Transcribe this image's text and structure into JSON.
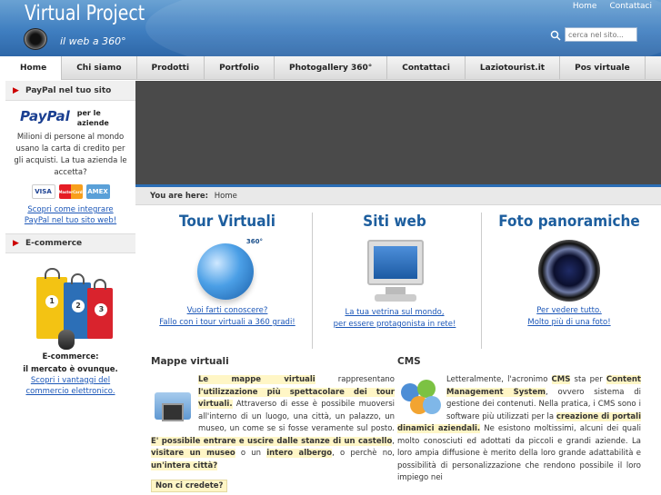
{
  "header": {
    "title": "Virtual Project",
    "subtitle": "il web a 360°",
    "top_links": [
      "Home",
      "Contattaci"
    ],
    "search_placeholder": "cerca nel sito..."
  },
  "nav": [
    "Home",
    "Chi siamo",
    "Prodotti",
    "Portfolio",
    "Photogallery 360°",
    "Contattaci",
    "Laziotourist.it",
    "Pos virtuale"
  ],
  "sidebar": {
    "paypal": {
      "heading": "PayPal nel tuo sito",
      "logo_text": "PayPal",
      "logo_tagline": "per le aziende",
      "body": "Milioni di persone al mondo usano la carta di credito per gli acquisti. La tua azienda le accetta?",
      "cards": [
        "VISA",
        "MasterCard",
        "AMEX"
      ],
      "link1": "Scopri come integrare",
      "link2": "PayPal nel tuo sito web!"
    },
    "ecommerce": {
      "heading": "E-commerce",
      "bag_numbers": [
        "1",
        "2",
        "3"
      ],
      "title_line1": "E-commerce:",
      "title_line2": "il mercato è ovunque.",
      "link1": "Scopri i vantaggi del",
      "link2": "commercio elettronico."
    }
  },
  "breadcrumb": {
    "label": "You are here:",
    "current": "Home"
  },
  "features": [
    {
      "title": "Tour Virtuali",
      "badge": "360°",
      "link1": "Vuoi farti conoscere?",
      "link2": "Fallo con i tour virtuali a 360 gradi!"
    },
    {
      "title": "Siti web",
      "link1": "La tua vetrina sul mondo,",
      "link2": "per essere protagonista in rete!"
    },
    {
      "title": "Foto panoramiche",
      "link1": "Per vedere tutto.",
      "link2": "Molto più di una foto!"
    }
  ],
  "mappe": {
    "heading": "Mappe virtuali",
    "hl1": "Le mappe virtuali",
    "t1": " rappresentano ",
    "hl2": "l'utilizzazione più spettacolare dei tour virtuali.",
    "t2": " Attraverso di esse è possibile muoversi all'interno di un luogo, una città, un palazzo, un museo, un come se si fosse veramente sul posto. ",
    "hl3": "E' possibile entrare e uscire dalle stanze di un castello",
    "t3": ", ",
    "hl4": "visitare un museo",
    "t4": " o un ",
    "hl5": "intero albergo",
    "t5": ", o perchè no, ",
    "hl6": "un'intera città?",
    "button": "Non ci credete?"
  },
  "cms": {
    "heading": "CMS",
    "t1": "Letteralmente, l'acronimo ",
    "hl1": "CMS",
    "t2": " sta per ",
    "hl2": "Content Management System",
    "t3": ", ovvero sistema di gestione dei contenuti. Nella pratica, i CMS sono i software più utilizzati per la ",
    "hl3": "creazione di portali dinamici aziendali.",
    "t4": " Ne esistono moltissimi, alcuni dei quali molto conosciuti ed adottati da piccoli e grandi aziende. La loro ampia diffusione è merito della loro grande adattabilità e possibilità di personalizzazione che rendono possibile il loro impiego nei"
  }
}
